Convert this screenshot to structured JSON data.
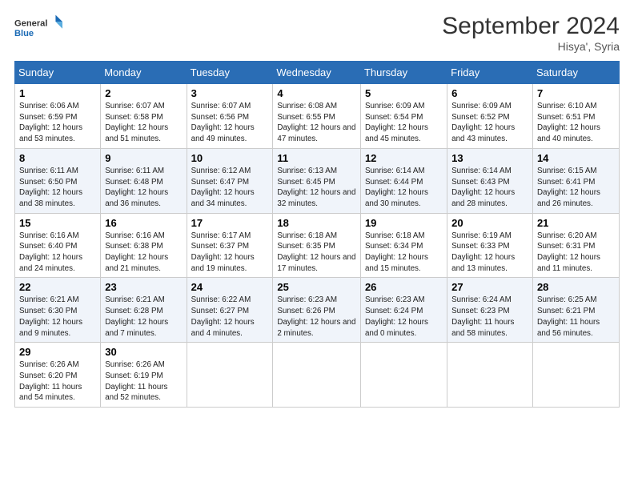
{
  "logo": {
    "line1": "General",
    "line2": "Blue"
  },
  "title": "September 2024",
  "location": "Hisya', Syria",
  "days_header": [
    "Sunday",
    "Monday",
    "Tuesday",
    "Wednesday",
    "Thursday",
    "Friday",
    "Saturday"
  ],
  "weeks": [
    [
      {
        "day": "1",
        "sunrise": "6:06 AM",
        "sunset": "6:59 PM",
        "daylight": "12 hours and 53 minutes."
      },
      {
        "day": "2",
        "sunrise": "6:07 AM",
        "sunset": "6:58 PM",
        "daylight": "12 hours and 51 minutes."
      },
      {
        "day": "3",
        "sunrise": "6:07 AM",
        "sunset": "6:56 PM",
        "daylight": "12 hours and 49 minutes."
      },
      {
        "day": "4",
        "sunrise": "6:08 AM",
        "sunset": "6:55 PM",
        "daylight": "12 hours and 47 minutes."
      },
      {
        "day": "5",
        "sunrise": "6:09 AM",
        "sunset": "6:54 PM",
        "daylight": "12 hours and 45 minutes."
      },
      {
        "day": "6",
        "sunrise": "6:09 AM",
        "sunset": "6:52 PM",
        "daylight": "12 hours and 43 minutes."
      },
      {
        "day": "7",
        "sunrise": "6:10 AM",
        "sunset": "6:51 PM",
        "daylight": "12 hours and 40 minutes."
      }
    ],
    [
      {
        "day": "8",
        "sunrise": "6:11 AM",
        "sunset": "6:50 PM",
        "daylight": "12 hours and 38 minutes."
      },
      {
        "day": "9",
        "sunrise": "6:11 AM",
        "sunset": "6:48 PM",
        "daylight": "12 hours and 36 minutes."
      },
      {
        "day": "10",
        "sunrise": "6:12 AM",
        "sunset": "6:47 PM",
        "daylight": "12 hours and 34 minutes."
      },
      {
        "day": "11",
        "sunrise": "6:13 AM",
        "sunset": "6:45 PM",
        "daylight": "12 hours and 32 minutes."
      },
      {
        "day": "12",
        "sunrise": "6:14 AM",
        "sunset": "6:44 PM",
        "daylight": "12 hours and 30 minutes."
      },
      {
        "day": "13",
        "sunrise": "6:14 AM",
        "sunset": "6:43 PM",
        "daylight": "12 hours and 28 minutes."
      },
      {
        "day": "14",
        "sunrise": "6:15 AM",
        "sunset": "6:41 PM",
        "daylight": "12 hours and 26 minutes."
      }
    ],
    [
      {
        "day": "15",
        "sunrise": "6:16 AM",
        "sunset": "6:40 PM",
        "daylight": "12 hours and 24 minutes."
      },
      {
        "day": "16",
        "sunrise": "6:16 AM",
        "sunset": "6:38 PM",
        "daylight": "12 hours and 21 minutes."
      },
      {
        "day": "17",
        "sunrise": "6:17 AM",
        "sunset": "6:37 PM",
        "daylight": "12 hours and 19 minutes."
      },
      {
        "day": "18",
        "sunrise": "6:18 AM",
        "sunset": "6:35 PM",
        "daylight": "12 hours and 17 minutes."
      },
      {
        "day": "19",
        "sunrise": "6:18 AM",
        "sunset": "6:34 PM",
        "daylight": "12 hours and 15 minutes."
      },
      {
        "day": "20",
        "sunrise": "6:19 AM",
        "sunset": "6:33 PM",
        "daylight": "12 hours and 13 minutes."
      },
      {
        "day": "21",
        "sunrise": "6:20 AM",
        "sunset": "6:31 PM",
        "daylight": "12 hours and 11 minutes."
      }
    ],
    [
      {
        "day": "22",
        "sunrise": "6:21 AM",
        "sunset": "6:30 PM",
        "daylight": "12 hours and 9 minutes."
      },
      {
        "day": "23",
        "sunrise": "6:21 AM",
        "sunset": "6:28 PM",
        "daylight": "12 hours and 7 minutes."
      },
      {
        "day": "24",
        "sunrise": "6:22 AM",
        "sunset": "6:27 PM",
        "daylight": "12 hours and 4 minutes."
      },
      {
        "day": "25",
        "sunrise": "6:23 AM",
        "sunset": "6:26 PM",
        "daylight": "12 hours and 2 minutes."
      },
      {
        "day": "26",
        "sunrise": "6:23 AM",
        "sunset": "6:24 PM",
        "daylight": "12 hours and 0 minutes."
      },
      {
        "day": "27",
        "sunrise": "6:24 AM",
        "sunset": "6:23 PM",
        "daylight": "11 hours and 58 minutes."
      },
      {
        "day": "28",
        "sunrise": "6:25 AM",
        "sunset": "6:21 PM",
        "daylight": "11 hours and 56 minutes."
      }
    ],
    [
      {
        "day": "29",
        "sunrise": "6:26 AM",
        "sunset": "6:20 PM",
        "daylight": "11 hours and 54 minutes."
      },
      {
        "day": "30",
        "sunrise": "6:26 AM",
        "sunset": "6:19 PM",
        "daylight": "11 hours and 52 minutes."
      },
      null,
      null,
      null,
      null,
      null
    ]
  ]
}
